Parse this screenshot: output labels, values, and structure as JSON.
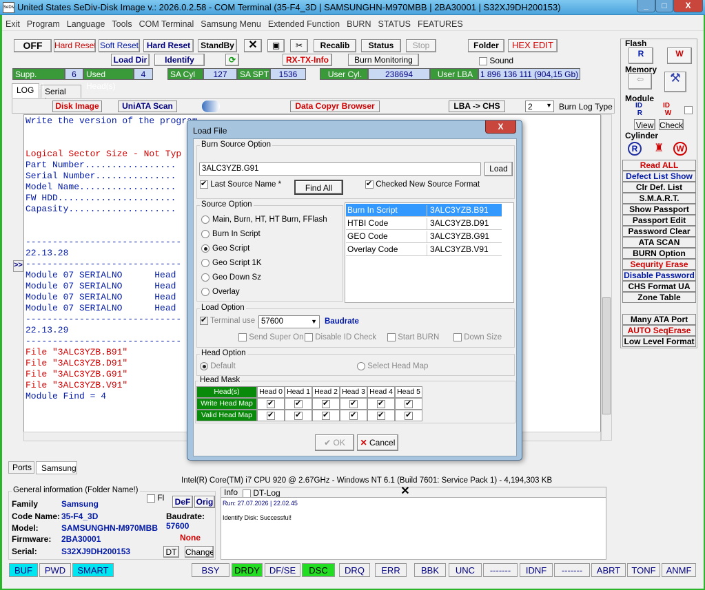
{
  "window": {
    "title": "United States  SeDiv-Disk Image v.: 2026.0.2.58 - COM Terminal  (35-F4_3D | SAMSUNGHN-M970MBB | 2BA30001 | S32XJ9DH200153)",
    "icon_text": "SeDiv",
    "min": "_",
    "max": "□",
    "close": "X"
  },
  "menu": [
    "Exit",
    "Program",
    "Language",
    "Tools",
    "COM Terminal",
    "Samsung Menu",
    "Extended Function",
    "BURN",
    "STATUS",
    "FEATURES"
  ],
  "toolbar": {
    "off": "OFF",
    "hard_reset_red": "Hard Reset",
    "soft_reset": "Soft Reset",
    "hard_reset": "Hard Reset",
    "standby": "StandBy",
    "recalib": "Recalib",
    "status": "Status",
    "stop": "Stop",
    "folder": "Folder",
    "hex_edit": "HEX EDIT",
    "load_dir": "Load Dir",
    "identify": "Identify",
    "rx_tx": "RX-TX-Info",
    "burn_monitoring": "Burn Monitoring",
    "sound": "Sound"
  },
  "info": {
    "supp_heads_label": "Supp. Head(s)",
    "supp_heads": "6",
    "used_heads_label": "Used Head(s)",
    "used_heads": "4",
    "sa_cyl_label": "SA Cyl",
    "sa_cyl": "127",
    "sa_spt_label": "SA SPT",
    "sa_spt": "1536",
    "user_cyl_label": "User Cyl.",
    "user_cyl": "238694",
    "user_lba_label": "User LBA",
    "user_lba": "1 896 136 111  (904,15 Gb)"
  },
  "tabs": {
    "log": "LOG",
    "serial_log": "Serial Log"
  },
  "log_toolbar": {
    "disk_image": "Disk Image",
    "uniata": "UniATA Scan",
    "copyr": "Data Copyr Browser",
    "lba_chs": "LBA -> CHS",
    "burn_log_value": "2",
    "burn_log_type": "Burn Log Type"
  },
  "log_lines": [
    {
      "text": "Write the version of the program",
      "color": "#0018a8"
    },
    {
      "text": "",
      "color": "#000"
    },
    {
      "text": "",
      "color": "#000"
    },
    {
      "text": "Logical Sector Size - Not Typ",
      "color": "#d00000"
    },
    {
      "text": "Part Number.................",
      "color": "#0018a8"
    },
    {
      "text": "Serial Number...............",
      "color": "#0018a8"
    },
    {
      "text": "Model Name..................",
      "color": "#0018a8"
    },
    {
      "text": "FW HDD......................",
      "color": "#0018a8"
    },
    {
      "text": "Capasity....................",
      "color": "#0018a8"
    },
    {
      "text": "",
      "color": "#000"
    },
    {
      "text": "",
      "color": "#000"
    },
    {
      "text": "-----------------------------",
      "color": "#0018a8"
    },
    {
      "text": "22.13.28",
      "color": "#0018a8"
    },
    {
      "text": "-----------------------------",
      "color": "#0018a8"
    },
    {
      "text": "Module 07 SERIALNO      Head",
      "color": "#0018a8"
    },
    {
      "text": "Module 07 SERIALNO      Head",
      "color": "#0018a8"
    },
    {
      "text": "Module 07 SERIALNO      Head",
      "color": "#0018a8"
    },
    {
      "text": "Module 07 SERIALNO      Head",
      "color": "#0018a8"
    },
    {
      "text": "-----------------------------",
      "color": "#0018a8"
    },
    {
      "text": "22.13.29",
      "color": "#0018a8"
    },
    {
      "text": "-----------------------------",
      "color": "#0018a8"
    },
    {
      "text": "File \"3ALC3YZB.B91\"",
      "color": "#d00000"
    },
    {
      "text": "File \"3ALC3YZB.D91\"",
      "color": "#d00000"
    },
    {
      "text": "File \"3ALC3YZB.G91\"",
      "color": "#d00000"
    },
    {
      "text": "File \"3ALC3YZB.V91\"",
      "color": "#d00000"
    },
    {
      "text": "Module Find = 4",
      "color": "#0018a8"
    }
  ],
  "side_arrow": ">>",
  "right_panel": {
    "flash": "Flash",
    "memory": "Memory",
    "module": "Module",
    "view": "View",
    "check": "Check",
    "cylinder": "Cylinder",
    "buttons": [
      {
        "label": "Read ALL",
        "color": "#d00000"
      },
      {
        "label": "Defect List Show",
        "color": "#0018a8"
      },
      {
        "label": "Clr Def. List",
        "color": "#000"
      },
      {
        "label": "S.M.A.R.T.",
        "color": "#000"
      },
      {
        "label": "Show Passport",
        "color": "#000"
      },
      {
        "label": "Passport Edit",
        "color": "#000"
      },
      {
        "label": "Password Clear",
        "color": "#000"
      },
      {
        "label": "ATA SCAN",
        "color": "#000"
      },
      {
        "label": "BURN Option",
        "color": "#000"
      },
      {
        "label": "Sequrity Erase",
        "color": "#d00000"
      },
      {
        "label": "Disable Password",
        "color": "#0018a8"
      },
      {
        "label": "CHS Format UA",
        "color": "#000"
      },
      {
        "label": "Zone Table",
        "color": "#000"
      }
    ],
    "buttons2": [
      {
        "label": "Many ATA Port",
        "color": "#000"
      },
      {
        "label": "AUTO SeqErase",
        "color": "#d00000"
      },
      {
        "label": "Low Level Format",
        "color": "#000"
      }
    ]
  },
  "bottom_tabs": {
    "ports": "Ports",
    "samsung": "Samsung"
  },
  "cpu_line": "Intel(R) Core(TM) i7 CPU 920  @ 2.67GHz - Windows NT 6.1 (Build 7601: Service Pack 1) - 4,194,303 KB",
  "general": {
    "title": "General information (Folder Name!)",
    "fl": "Fl",
    "def": "DeF",
    "orig": "Orig",
    "family_label": "Family",
    "family": "Samsung",
    "code_label": "Code Name:",
    "code": "35-F4_3D",
    "model_label": "Model:",
    "model": "SAMSUNGHN-M970MBB",
    "firmware_label": "Firmware:",
    "firmware": "2BA30001",
    "serial_label": "Serial:",
    "serial": "S32XJ9DH200153",
    "baud_label": "Baudrate:",
    "baud": "57600",
    "none": "None",
    "dt": "DT",
    "change": "Change"
  },
  "infopanel": {
    "info": "Info",
    "dtlog": "DT-Log",
    "run": "Run: 27.07.2026 | 22.02.45",
    "msg": "Identify Disk: Successful!"
  },
  "status": [
    {
      "label": "BUF",
      "style": "cyan"
    },
    {
      "label": "PWD",
      "style": ""
    },
    {
      "label": "SMART",
      "style": "cyan"
    },
    {
      "label": "BSY",
      "style": ""
    },
    {
      "label": "DRDY",
      "style": "green"
    },
    {
      "label": "DF/SE",
      "style": ""
    },
    {
      "label": "DSC",
      "style": "green"
    },
    {
      "label": "DRQ",
      "style": ""
    },
    {
      "label": "ERR",
      "style": ""
    },
    {
      "label": "BBK",
      "style": ""
    },
    {
      "label": "UNC",
      "style": ""
    },
    {
      "label": "-------",
      "style": ""
    },
    {
      "label": "IDNF",
      "style": ""
    },
    {
      "label": "-------",
      "style": ""
    },
    {
      "label": "ABRT",
      "style": ""
    },
    {
      "label": "TONF",
      "style": ""
    },
    {
      "label": "ANMF",
      "style": ""
    }
  ],
  "dialog": {
    "title": "Load File",
    "burn_source": "Burn Source Option",
    "file_value": "3ALC3YZB.G91",
    "load": "Load",
    "last_source": "Last Source Name *",
    "find_all": "Find All",
    "checked_new": "Checked New Source Format",
    "source_option": "Source Option",
    "radios": [
      "Main, Burn, HT, HT Burn, FFlash",
      "Burn In Script",
      "Geo Script",
      "Geo Script 1K",
      "Geo Down Sz",
      "Overlay"
    ],
    "selected_radio": 2,
    "list": [
      {
        "name": "Burn In Script",
        "file": "3ALC3YZB.B91"
      },
      {
        "name": "HTBI Code",
        "file": "3ALC3YZB.D91"
      },
      {
        "name": "GEO Code",
        "file": "3ALC3YZB.G91"
      },
      {
        "name": "Overlay Code",
        "file": "3ALC3YZB.V91"
      }
    ],
    "load_option": "Load Option",
    "terminal_use": "Terminal use",
    "baud": "57600",
    "baudrate": "Baudrate",
    "send_super_on": "Send Super On",
    "disable_id_check": "Disable ID Check",
    "start_burn": "Start BURN",
    "down_size": "Down Size",
    "head_option": "Head Option",
    "default": "Default",
    "select_head_map": "Select Head Map",
    "head_mask": "Head Mask",
    "heads_header": "Head(s)",
    "head_cols": [
      "Head 0",
      "Head 1",
      "Head 2",
      "Head 3",
      "Head 4",
      "Head 5"
    ],
    "write_map": "Write Head Map",
    "valid_map": "Valid Head Map",
    "ok": "OK",
    "cancel": "Cancel",
    "close": "X"
  }
}
